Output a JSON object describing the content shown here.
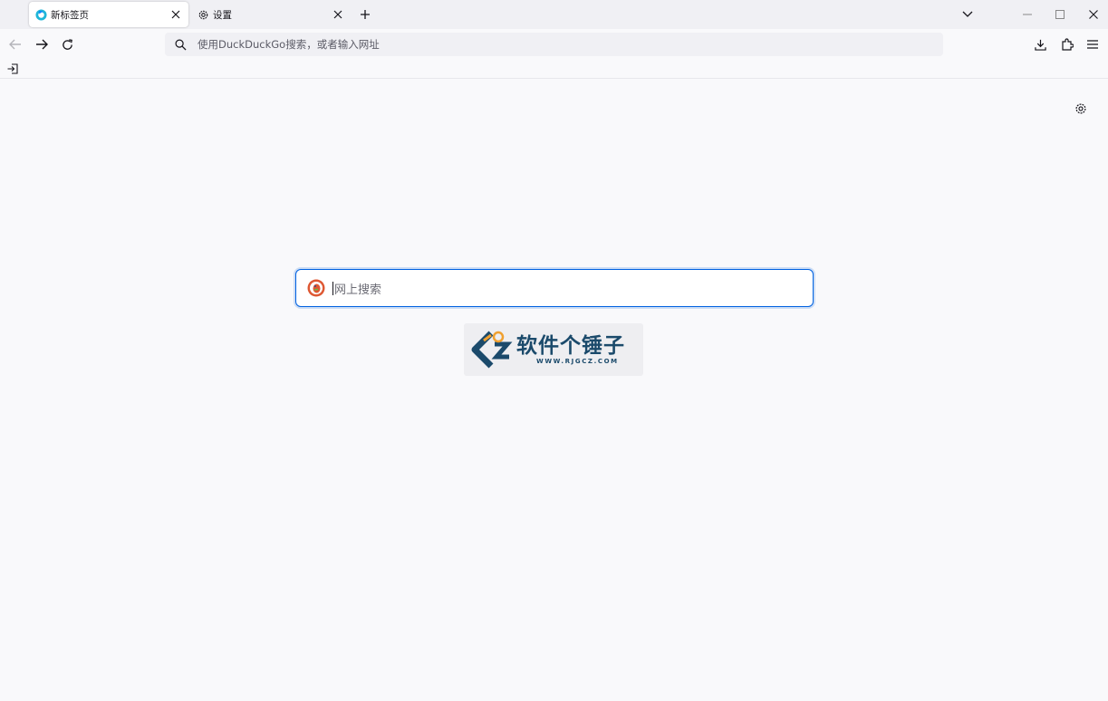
{
  "tabs": [
    {
      "label": "新标签页",
      "active": true,
      "icon": "firefox-icon"
    },
    {
      "label": "设置",
      "active": false,
      "icon": "gear-icon"
    }
  ],
  "urlbar": {
    "placeholder": "使用DuckDuckGo搜索，或者输入网址"
  },
  "search": {
    "placeholder": "网上搜索",
    "engine_icon": "duckduckgo-icon"
  },
  "watermark": {
    "title": "软件个锤子",
    "url": "WWW.RJGCZ.COM"
  },
  "colors": {
    "accent": "#0061e0",
    "tabstrip": "#f0f0f4",
    "content_bg": "#f9f9fb",
    "watermark_text": "#1b4a6b",
    "watermark_orange": "#f0a030"
  }
}
